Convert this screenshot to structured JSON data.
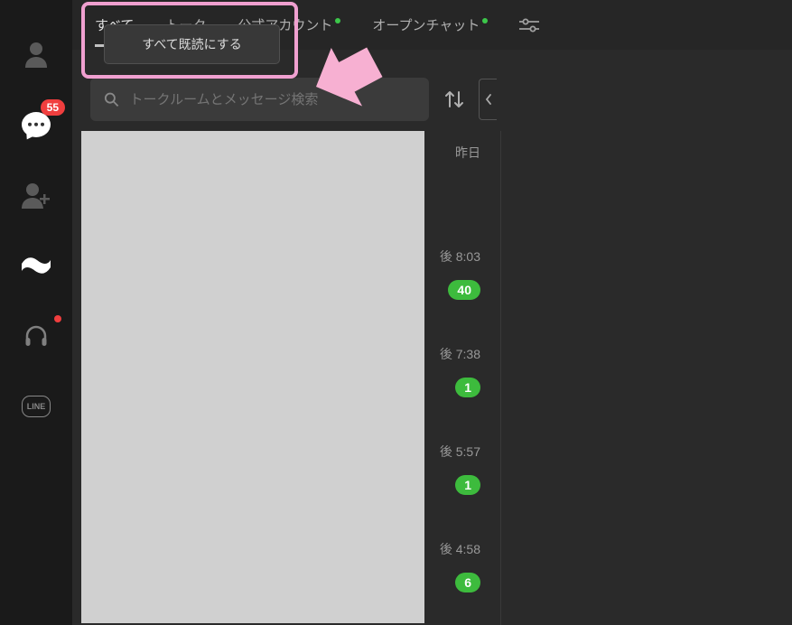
{
  "rail": {
    "chat_badge": "55"
  },
  "tabs": {
    "all": "すべて",
    "friends": "トーク",
    "official": "公式アカウント",
    "openchat": "オープンチャット"
  },
  "context_menu": {
    "mark_all_read": "すべて既読にする"
  },
  "search": {
    "placeholder": "トークルームとメッセージ検索"
  },
  "chats": [
    {
      "time": "昨日",
      "badge": null
    },
    {
      "time": "後 8:03",
      "badge": "40"
    },
    {
      "time": "後 7:38",
      "badge": "1"
    },
    {
      "time": "後 5:57",
      "badge": "1"
    },
    {
      "time": "後 4:58",
      "badge": "6"
    }
  ]
}
